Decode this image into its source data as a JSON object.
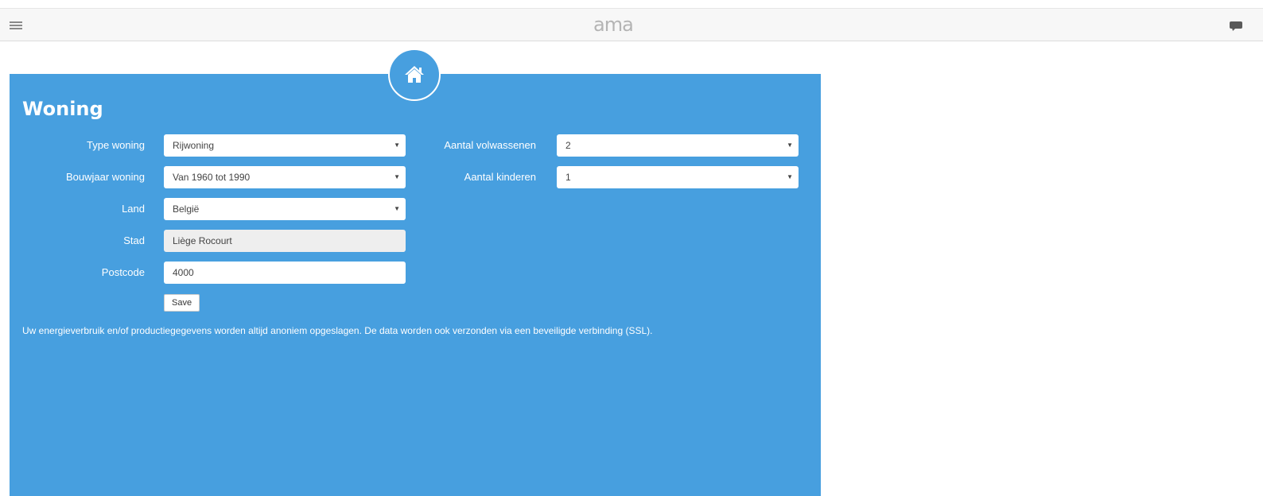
{
  "header": {
    "logo": "ama",
    "menu_icon": "hamburger-menu-icon",
    "chat_icon": "chat-bubble-icon"
  },
  "panel": {
    "icon": "home-icon",
    "title": "Woning",
    "accent_color": "#479fdf",
    "fields": {
      "type_woning": {
        "label": "Type woning",
        "value": "Rijwoning"
      },
      "bouwjaar": {
        "label": "Bouwjaar woning",
        "value": "Van 1960 tot 1990"
      },
      "land": {
        "label": "Land",
        "value": "België"
      },
      "stad": {
        "label": "Stad",
        "value": "Liège Rocourt"
      },
      "postcode": {
        "label": "Postcode",
        "value": "4000"
      },
      "volwassenen": {
        "label": "Aantal volwassenen",
        "value": "2"
      },
      "kinderen": {
        "label": "Aantal kinderen",
        "value": "1"
      }
    },
    "save_label": "Save",
    "notice": "Uw energieverbruik en/of productiegegevens worden altijd anoniem opgeslagen. De data worden ook verzonden via een beveiligde verbinding (SSL)."
  }
}
